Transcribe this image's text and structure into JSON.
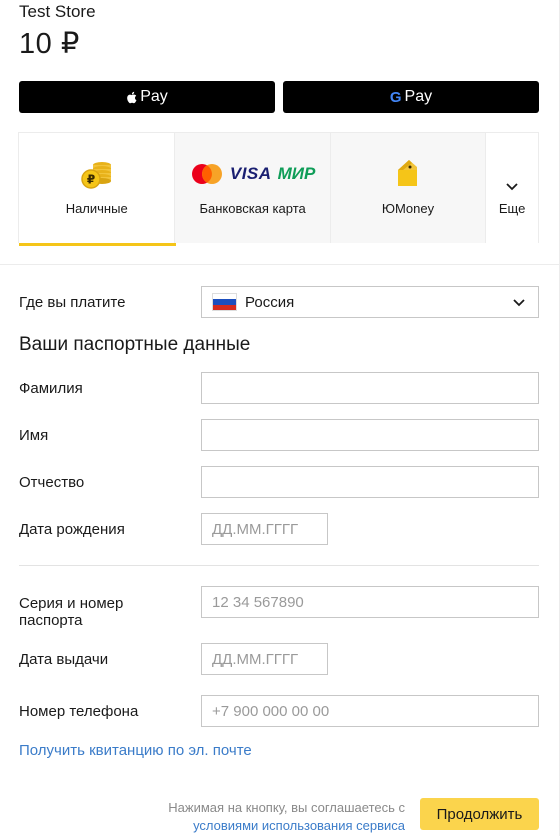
{
  "header": {
    "store_name": "Test Store",
    "amount": "10 ₽"
  },
  "wallets": {
    "apple_pay_label": "Pay",
    "google_pay_label": "Pay",
    "google_letter": "G"
  },
  "payment_methods": {
    "items": [
      {
        "label": "Наличные",
        "icon": "coins-icon"
      },
      {
        "label": "Банковская карта",
        "icon": "bank-cards-icon"
      },
      {
        "label": "ЮMoney",
        "icon": "yumoney-wallet-icon"
      },
      {
        "label": "Еще",
        "icon": "chevron-down-icon"
      }
    ],
    "card_brands": {
      "visa": "VISA",
      "mir": "МИР"
    },
    "active_index": 0,
    "accent_color": "#f5c518"
  },
  "form": {
    "country_label": "Где вы платите",
    "country_value": "Россия",
    "section_title": "Ваши паспортные данные",
    "last_name_label": "Фамилия",
    "last_name_value": "",
    "first_name_label": "Имя",
    "first_name_value": "",
    "patronymic_label": "Отчество",
    "patronymic_value": "",
    "birthdate_label": "Дата рождения",
    "birthdate_placeholder": "ДД.ММ.ГГГГ",
    "passport_label": "Серия и номер паспорта",
    "passport_placeholder": "12 34 567890",
    "issue_date_label": "Дата выдачи",
    "issue_date_placeholder": "ДД.ММ.ГГГГ",
    "phone_label": "Номер телефона",
    "phone_placeholder": "+7 900 000 00 00"
  },
  "receipt_link": "Получить квитанцию по эл. почте",
  "footer": {
    "terms_text": "Нажимая на кнопку, вы соглашаетесь с",
    "terms_link": "условиями использования сервиса",
    "continue_label": "Продолжить",
    "continue_color": "#fbd44c",
    "link_color": "#3b7cc9"
  }
}
